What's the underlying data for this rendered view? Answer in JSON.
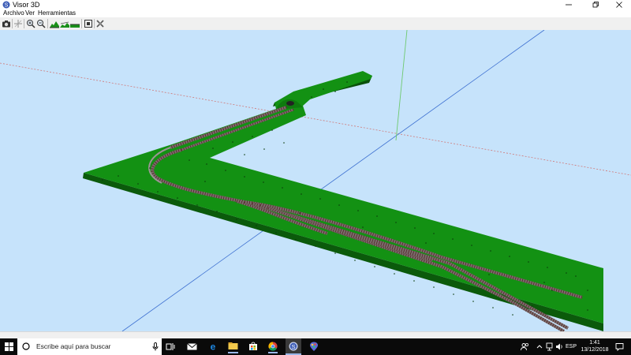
{
  "window": {
    "title": "Visor 3D",
    "icon": "visor-app-icon",
    "controls": [
      "minimize-icon",
      "restore-icon",
      "close-icon"
    ]
  },
  "menu": {
    "items": [
      {
        "label": "Archivo"
      },
      {
        "label": "Ver"
      },
      {
        "label": "Herramientas"
      }
    ]
  },
  "toolbar": {
    "buttons": [
      "camera-icon",
      "axes-icon",
      "zoom-in-icon",
      "zoom-out-icon",
      "terrain-view-1-icon",
      "terrain-view-2-icon",
      "terrain-view-3-icon",
      "fit-view-icon",
      "settings-icon"
    ]
  },
  "viewport": {
    "background": "#c6e3fb",
    "terrain_color": "#139113",
    "track_color": "#7a6d6d",
    "sleeper_color": "#5a2f2f"
  },
  "taskbar": {
    "search_placeholder": "Escribe aquí para buscar",
    "apps": [
      "task-view-icon",
      "mail-icon",
      "edge-icon",
      "file-explorer-icon",
      "store-icon",
      "chrome-icon",
      "visor-app-icon",
      "paint-icon"
    ],
    "tray": {
      "language": "ESP",
      "time": "1:41",
      "date": "13/12/2018"
    }
  }
}
